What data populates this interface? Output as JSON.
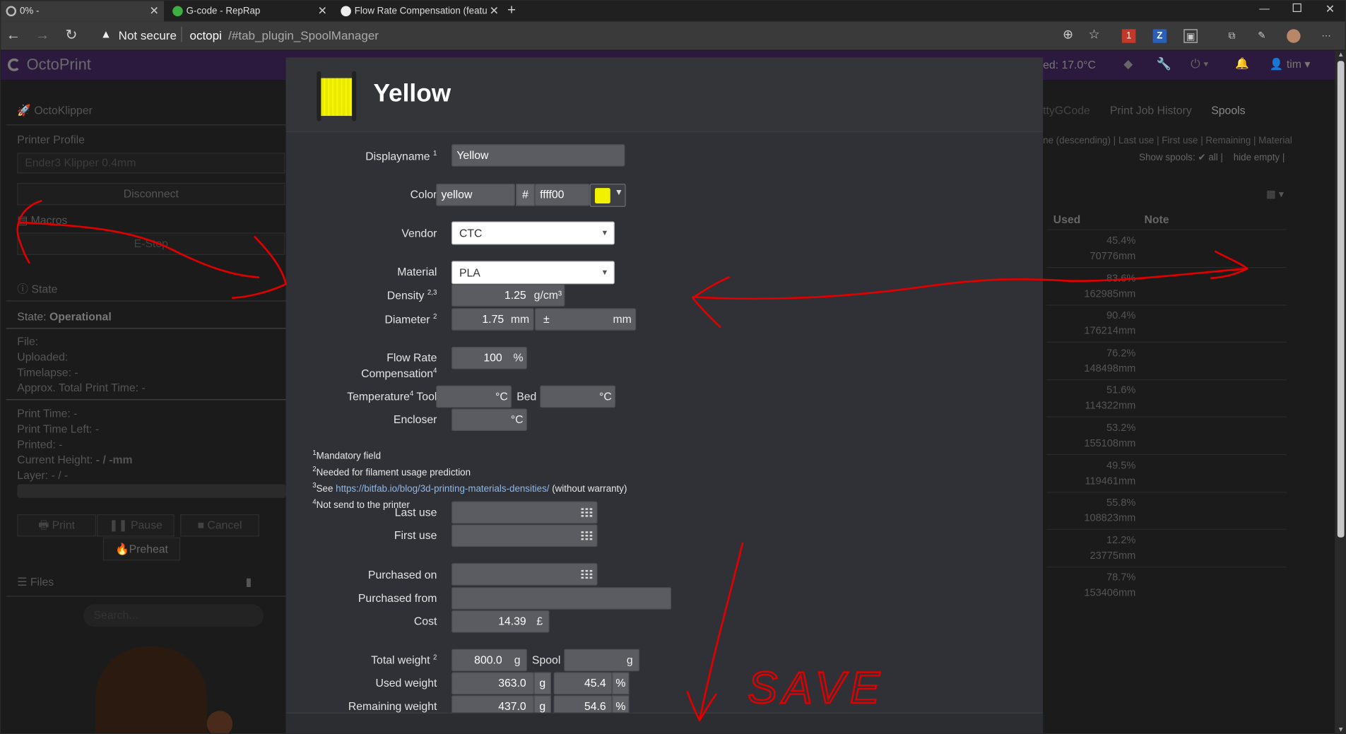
{
  "browser": {
    "tabs": [
      {
        "label": "0% -"
      },
      {
        "label": "G-code - RepRap"
      },
      {
        "label": "Flow Rate Compensation (featur"
      }
    ],
    "url_warning": "Not secure",
    "url_host": "octopi",
    "url_path": "/#tab_plugin_SpoolManager",
    "zoom_badge": "1"
  },
  "octoprint": {
    "brand": "OctoPrint",
    "temp_readout": "ed: 17.0°C",
    "user": "tim",
    "sidebar": {
      "octoklipper": "OctoKlipper",
      "printer_profile_label": "Printer Profile",
      "printer_profile_value": "Ender3 Klipper 0.4mm",
      "disconnect": "Disconnect",
      "macros": "Macros",
      "estop": "E-Stop",
      "state_heading": "State",
      "state_label": "State:",
      "state_value": "Operational",
      "file": "File:",
      "uploaded": "Uploaded:",
      "timelapse": "Timelapse: -",
      "approx_total": "Approx. Total Print Time: -",
      "print_time": "Print Time: -",
      "print_time_left": "Print Time Left: -",
      "printed": "Printed: -",
      "current_height_label": "Current Height:",
      "current_height_value": "- / -mm",
      "layer": "Layer: - / -",
      "print_btn": "Print",
      "pause_btn": "Pause",
      "cancel_btn": "Cancel",
      "preheat_btn": "Preheat",
      "files_heading": "Files",
      "search_placeholder": "Search..."
    },
    "right_tabs": [
      "ttyGCode",
      "Print Job History",
      "Spools"
    ],
    "sort_line": "ne (descending) | Last use | First use | Remaining | Material",
    "show_spools_label": "Show spools:",
    "show_all": "all |",
    "hide_empty": "hide empty |",
    "table": {
      "headers": [
        "Used",
        "Note"
      ],
      "rows": [
        {
          "pct": "45.4%",
          "mm": "70776mm"
        },
        {
          "pct": "83.6%",
          "mm": "162985mm"
        },
        {
          "pct": "90.4%",
          "mm": "176214mm"
        },
        {
          "pct": "76.2%",
          "mm": "148498mm"
        },
        {
          "pct": "51.6%",
          "mm": "114322mm"
        },
        {
          "pct": "53.2%",
          "mm": "155108mm"
        },
        {
          "pct": "49.5%",
          "mm": "119461mm"
        },
        {
          "pct": "55.8%",
          "mm": "108823mm"
        },
        {
          "pct": "12.2%",
          "mm": "23775mm"
        },
        {
          "pct": "78.7%",
          "mm": "153406mm"
        }
      ]
    }
  },
  "modal": {
    "title": "Yellow",
    "spool_color": "#f2f200",
    "fields": {
      "displayname_label": "Displayname",
      "displayname_value": "Yellow",
      "color_label": "Color",
      "color_name": "yellow",
      "hash": "#",
      "color_hex": "ffff00",
      "vendor_label": "Vendor",
      "vendor_value": "CTC",
      "material_label": "Material",
      "material_value": "PLA",
      "density_label": "Density",
      "density_value": "1.25",
      "density_unit": "g/cm³",
      "diameter_label": "Diameter",
      "diameter_value": "1.75",
      "mm": "mm",
      "plusminus": "±",
      "flow_label_1": "Flow Rate",
      "flow_label_2": "Compensation",
      "flow_value": "100",
      "percent": "%",
      "temperature_label": "Temperature",
      "tool_label": "Tool",
      "celsius": "°C",
      "bed_label": "Bed",
      "encloser_label": "Encloser",
      "last_use_label": "Last use",
      "first_use_label": "First use",
      "purchased_on_label": "Purchased on",
      "purchased_from_label": "Purchased from",
      "cost_label": "Cost",
      "cost_value": "14.39",
      "currency": "£",
      "total_weight_label": "Total weight",
      "total_weight_value": "800.0",
      "g": "g",
      "spool_label": "Spool",
      "used_weight_label": "Used weight",
      "used_weight_value": "363.0",
      "used_pct": "45.4",
      "remaining_weight_label": "Remaining weight",
      "remaining_weight_value": "437.0",
      "remaining_pct": "54.6"
    },
    "notes": {
      "n1": "Mandatory field",
      "n2": "Needed for filament usage prediction",
      "n3_pre": "See",
      "n3_link": "https://bitfab.io/blog/3d-printing-materials-densities/",
      "n3_post": "(without warranty)",
      "n4": "Not send to the printer"
    }
  },
  "annotations": {
    "handwritten_text": "SAVE",
    "ink_color": "#e00000"
  }
}
